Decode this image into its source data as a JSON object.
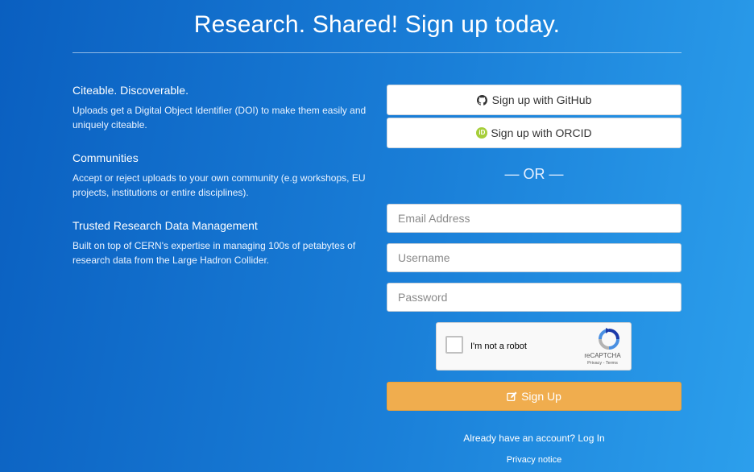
{
  "headline": "Research. Shared! Sign up today.",
  "features": [
    {
      "title": "Citeable. Discoverable.",
      "text": "Uploads get a Digital Object Identifier (DOI) to make them easily and uniquely citeable."
    },
    {
      "title": "Communities",
      "text": "Accept or reject uploads to your own community (e.g workshops, EU projects, institutions or entire disciplines)."
    },
    {
      "title": "Trusted Research Data Management",
      "text": "Built on top of CERN's expertise in managing 100s of petabytes of research data from the Large Hadron Collider."
    }
  ],
  "form": {
    "github_label": "Sign up with GitHub",
    "orcid_label": "Sign up with ORCID",
    "orcid_badge": "iD",
    "or_label": "— OR —",
    "email_placeholder": "Email Address",
    "username_placeholder": "Username",
    "password_placeholder": "Password",
    "captcha_label": "I'm not a robot",
    "captcha_brand": "reCAPTCHA",
    "captcha_terms": "Privacy - Terms",
    "signup_label": "Sign Up",
    "login_prompt": "Already have an account?",
    "login_link": "Log In",
    "privacy_link": "Privacy notice"
  },
  "icons": {
    "github": "github-icon",
    "orcid": "orcid-icon",
    "signup": "edit-icon",
    "recaptcha": "recaptcha-icon"
  },
  "colors": {
    "accent_button": "#f0ad4e",
    "orcid_green": "#a6ce39"
  }
}
